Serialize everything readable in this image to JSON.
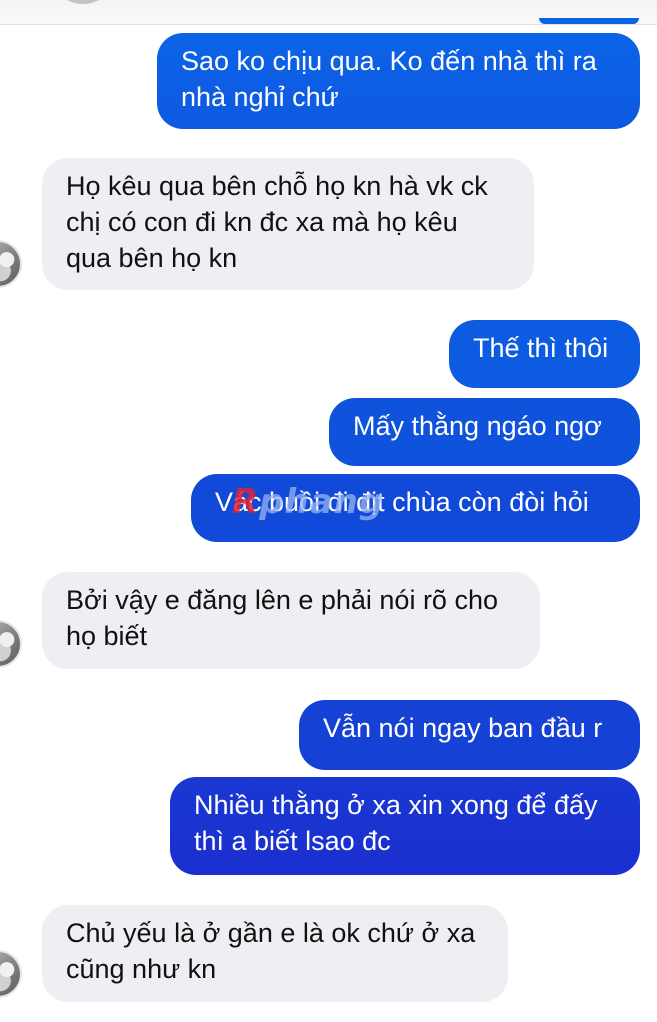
{
  "conversation": {
    "colors": {
      "outgoing_top": "#0b63e6",
      "outgoing_bottom": "#1a2fd0",
      "incoming_bg": "#eeeff2",
      "incoming_text": "#111111"
    },
    "messages": [
      {
        "side": "out",
        "text": "Sao ko chịu qua. Ko đến nhà thì ra\nnhà nghỉ chứ"
      },
      {
        "side": "in",
        "text": "Họ kêu qua bên chỗ họ kn hà vk ck\nchị có con đi kn đc xa mà họ kêu\nqua bên họ kn"
      },
      {
        "side": "out",
        "text": "Thế thì thôi"
      },
      {
        "side": "out",
        "text": "Mấy thằng ngáo ngơ"
      },
      {
        "side": "out",
        "text": "Vác buồi đi địt chùa còn đòi hỏi"
      },
      {
        "side": "in",
        "text": "Bởi vậy e đăng lên e phải nói rõ cho\nhọ biết"
      },
      {
        "side": "out",
        "text": "Vẫn nói ngay ban đầu r"
      },
      {
        "side": "out",
        "text": "Nhiều thằng ở xa xin xong để đấy\nthì a biết lsao đc"
      },
      {
        "side": "in",
        "text": "Chủ yếu là ở gần e là ok chứ ở xa\ncũng như kn"
      }
    ]
  },
  "watermark": {
    "logo_letter": "R",
    "text": "phang",
    "icon": "watermark-logo"
  }
}
